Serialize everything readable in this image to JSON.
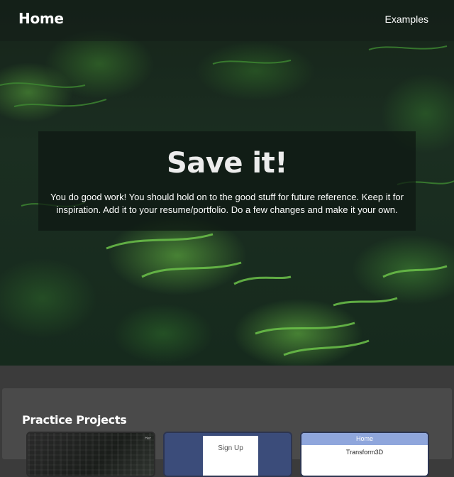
{
  "navbar": {
    "brand": "Home",
    "link": "Examples"
  },
  "hero": {
    "title": "Save it!",
    "text": "You do good work! You should hold on to the good stuff for future reference. Keep it for inspiration. Add it to your resume/portfolio. Do a few changes and make it your own."
  },
  "projects": {
    "title": "Practice Projects",
    "cards": [
      {
        "tag": "Her"
      },
      {
        "label": "Sign Up"
      },
      {
        "bar_label": "Home",
        "sub_label": "Transform3D"
      }
    ]
  },
  "colors": {
    "hero_overlay": "#0e1812",
    "section_bg": "#4a4a4a",
    "page_bg": "#3b3b3b",
    "signup_card_bg": "#3b4c7a",
    "home_bar": "#8fa6dc"
  },
  "icons": []
}
